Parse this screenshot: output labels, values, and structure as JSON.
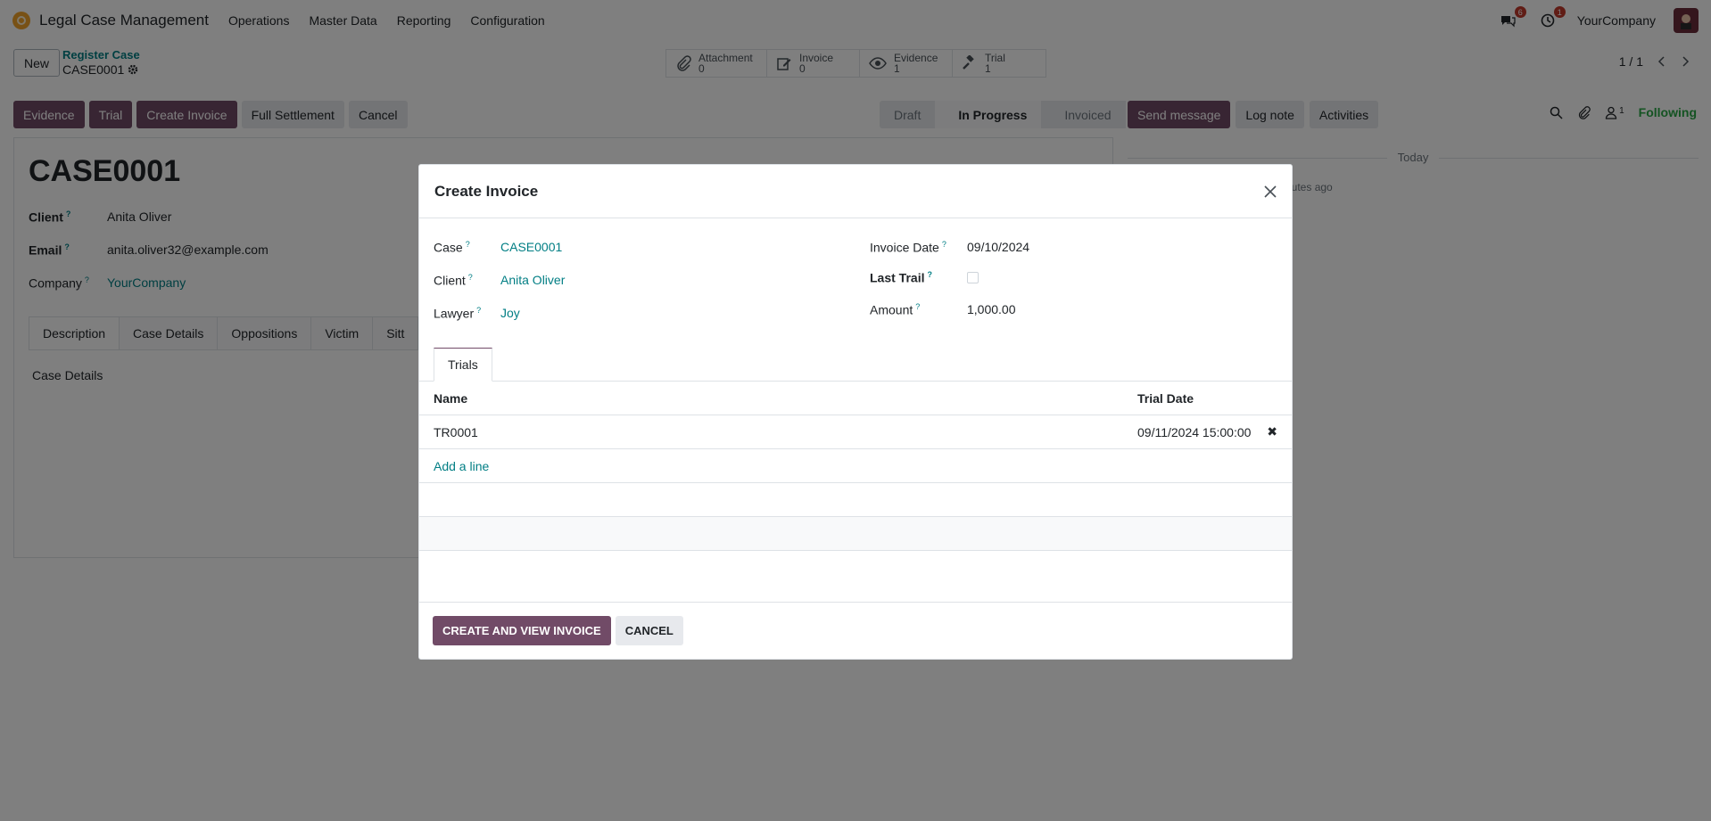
{
  "navbar": {
    "app_title": "Legal Case Management",
    "menus": [
      "Operations",
      "Master Data",
      "Reporting",
      "Configuration"
    ],
    "messages_badge": "6",
    "activities_badge": "1",
    "company": "YourCompany"
  },
  "control_panel": {
    "new_label": "New",
    "breadcrumb_parent": "Register Case",
    "breadcrumb_current": "CASE0001",
    "smart_buttons": [
      {
        "label": "Attachment",
        "count": "0",
        "icon": "paperclip-icon"
      },
      {
        "label": "Invoice",
        "count": "0",
        "icon": "edit-icon"
      },
      {
        "label": "Evidence",
        "count": "1",
        "icon": "eye-icon"
      },
      {
        "label": "Trial",
        "count": "1",
        "icon": "gavel-icon"
      }
    ],
    "pager": "1 / 1",
    "actions": [
      "Evidence",
      "Trial",
      "Create Invoice",
      "Full Settlement",
      "Cancel"
    ],
    "statuses": [
      "Draft",
      "In Progress",
      "Invoiced"
    ],
    "active_status": "In Progress",
    "chatter_actions": [
      "Send message",
      "Log note",
      "Activities"
    ],
    "followers_count": "1",
    "following_label": "Following"
  },
  "record": {
    "title": "CASE0001",
    "client_label": "Client",
    "client": "Anita Oliver",
    "email_label": "Email",
    "email": "anita.oliver32@example.com",
    "company_label": "Company",
    "company": "YourCompany",
    "tabs": [
      "Description",
      "Case Details",
      "Oppositions",
      "Victim",
      "Sitt"
    ],
    "tab_content": "Case Details"
  },
  "chatter": {
    "today_label": "Today",
    "time_ago": "nutes ago"
  },
  "modal": {
    "title": "Create Invoice",
    "case_label": "Case",
    "case": "CASE0001",
    "client_label": "Client",
    "client": "Anita Oliver",
    "lawyer_label": "Lawyer",
    "lawyer": "Joy",
    "invoice_date_label": "Invoice Date",
    "invoice_date": "09/10/2024",
    "last_trail_label": "Last Trail",
    "amount_label": "Amount",
    "amount": "1,000.00",
    "tab": "Trials",
    "columns": [
      "Name",
      "Trial Date"
    ],
    "rows": [
      {
        "name": "TR0001",
        "date": "09/11/2024 15:00:00"
      }
    ],
    "add_line": "Add a line",
    "primary_button": "CREATE AND VIEW INVOICE",
    "cancel_button": "CANCEL"
  },
  "colors": {
    "primary": "#714b67",
    "link": "#017e84",
    "following": "#28a745"
  }
}
